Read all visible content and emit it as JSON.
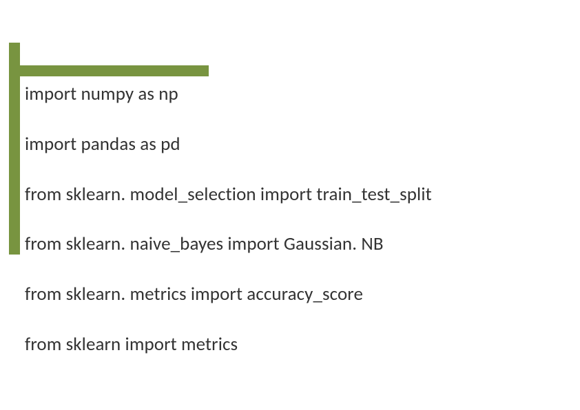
{
  "code": {
    "line1": "import numpy as np",
    "line2": "import pandas as pd",
    "line3": "from sklearn. model_selection import train_test_split",
    "line4": "from sklearn. naive_bayes import Gaussian. NB",
    "line5": "from sklearn. metrics import accuracy_score",
    "line6": "from sklearn import metrics"
  }
}
